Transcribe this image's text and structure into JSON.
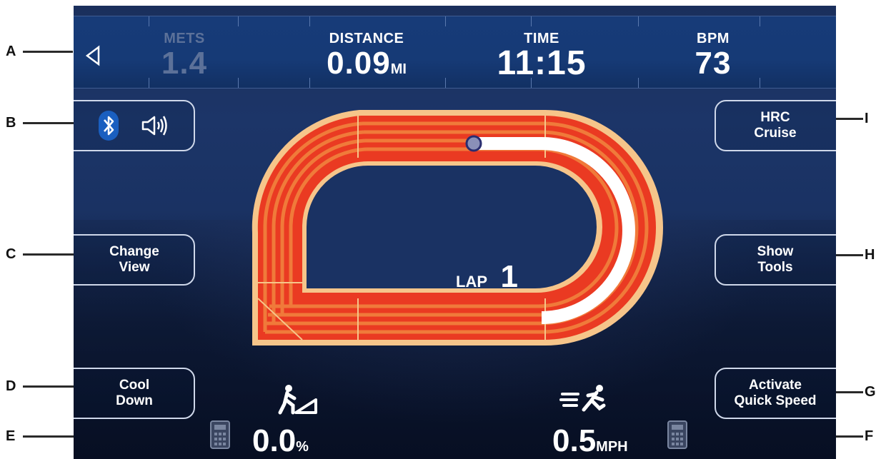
{
  "callouts": [
    "A",
    "B",
    "C",
    "D",
    "E",
    "F",
    "G",
    "H",
    "I"
  ],
  "stats": {
    "mets": {
      "label": "METS",
      "value": "1.4"
    },
    "distance": {
      "label": "DISTANCE",
      "value": "0.09",
      "unit": "MI"
    },
    "time": {
      "label": "TIME",
      "value": "11:15"
    },
    "bpm": {
      "label": "BPM",
      "value": "73"
    }
  },
  "buttons": {
    "change_view": "Change\nView",
    "cool_down": "Cool\nDown",
    "hrc_cruise": "HRC\nCruise",
    "show_tools": "Show\nTools",
    "quick_speed": "Activate\nQuick Speed"
  },
  "lap": {
    "label": "LAP",
    "value": "1"
  },
  "incline": {
    "value": "0.0",
    "unit": "%"
  },
  "speed": {
    "value": "0.5",
    "unit": "MPH"
  },
  "icons": [
    "back-triangle-icon",
    "bluetooth-icon",
    "speaker-icon",
    "incline-walker-icon",
    "running-speed-icon",
    "keypad-icon"
  ],
  "colors": {
    "track_red": "#e8321e",
    "track_orange": "#f07a3a",
    "track_border": "#f6c58a",
    "progress": "#ffffff"
  }
}
